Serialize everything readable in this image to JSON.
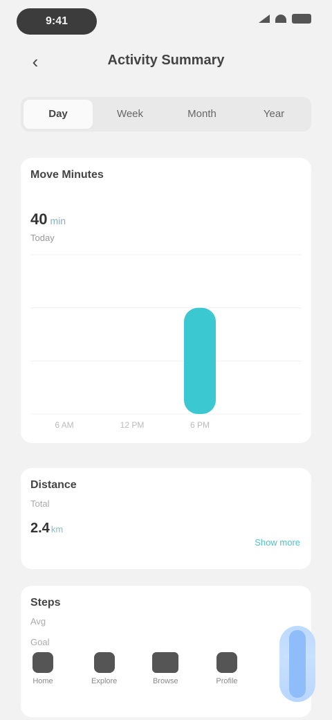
{
  "status": {
    "time": "9:41"
  },
  "nav": {
    "back_label": "‹",
    "title": "Activity Summary"
  },
  "segments": [
    "Day",
    "Week",
    "Month",
    "Year"
  ],
  "card_activity": {
    "title": "Move Minutes",
    "value": "40",
    "unit": "min",
    "sub": "Today",
    "accent": "#3cc8d0"
  },
  "chart_data": {
    "type": "bar",
    "categories": [
      "6 AM",
      "12 PM",
      "6 PM",
      ""
    ],
    "values": [
      0,
      0,
      40,
      0
    ],
    "ylim": [
      0,
      60
    ],
    "grid": true
  },
  "card_distance": {
    "title": "Distance",
    "sub": "Total",
    "value": "2.4",
    "unit": "km",
    "link": "Show more"
  },
  "card_steps": {
    "title": "Steps",
    "label": "Avg",
    "label2": "Goal"
  },
  "tabs": [
    {
      "label": "Home",
      "icon": "home-icon"
    },
    {
      "label": "Explore",
      "icon": "explore-icon"
    },
    {
      "label": "Browse",
      "icon": "browse-icon"
    },
    {
      "label": "Profile",
      "icon": "profile-icon"
    }
  ],
  "fab": {
    "icon": "mic-icon"
  }
}
